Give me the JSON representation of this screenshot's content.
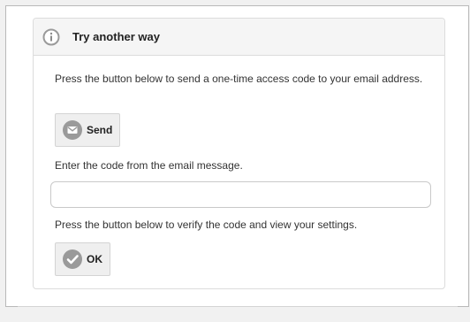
{
  "panel": {
    "title": "Try another way",
    "icon": "info-icon"
  },
  "email_step": {
    "instruction": "Press the button below to send a one-time access code to your email address.",
    "send_button_label": "Send",
    "send_icon": "envelope-icon"
  },
  "code_step": {
    "instruction": "Enter the code from the email message.",
    "input_value": "",
    "input_placeholder": ""
  },
  "verify_step": {
    "instruction": "Press the button below to verify the code and view your settings.",
    "ok_button_label": "OK",
    "ok_icon": "checkmark-icon"
  },
  "colors": {
    "icon_gray": "#9a9a9a",
    "button_bg": "#efefef",
    "header_bg": "#f5f5f5"
  }
}
